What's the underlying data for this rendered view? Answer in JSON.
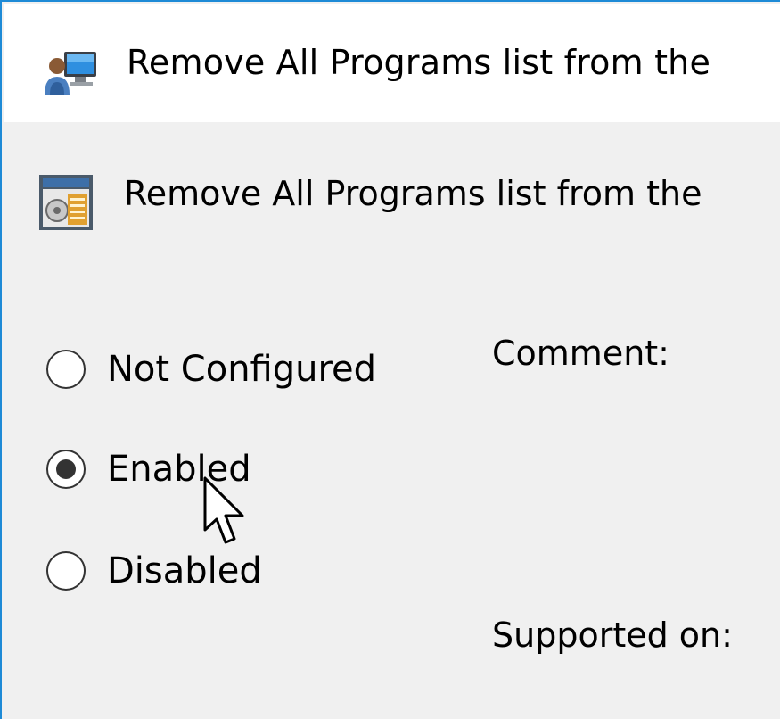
{
  "window": {
    "title": "Remove All Programs list from the"
  },
  "policy": {
    "name": "Remove All Programs list from the"
  },
  "state": {
    "options": [
      {
        "label": "Not Configured",
        "checked": false
      },
      {
        "label": "Enabled",
        "checked": true
      },
      {
        "label": "Disabled",
        "checked": false
      }
    ]
  },
  "fields": {
    "comment_label": "Comment:",
    "supported_label": "Supported on:"
  },
  "icons": {
    "title": "policy-computer-icon",
    "header": "policy-setting-icon"
  },
  "colors": {
    "accent": "#1e8ad6",
    "background": "#f0f0f0"
  }
}
